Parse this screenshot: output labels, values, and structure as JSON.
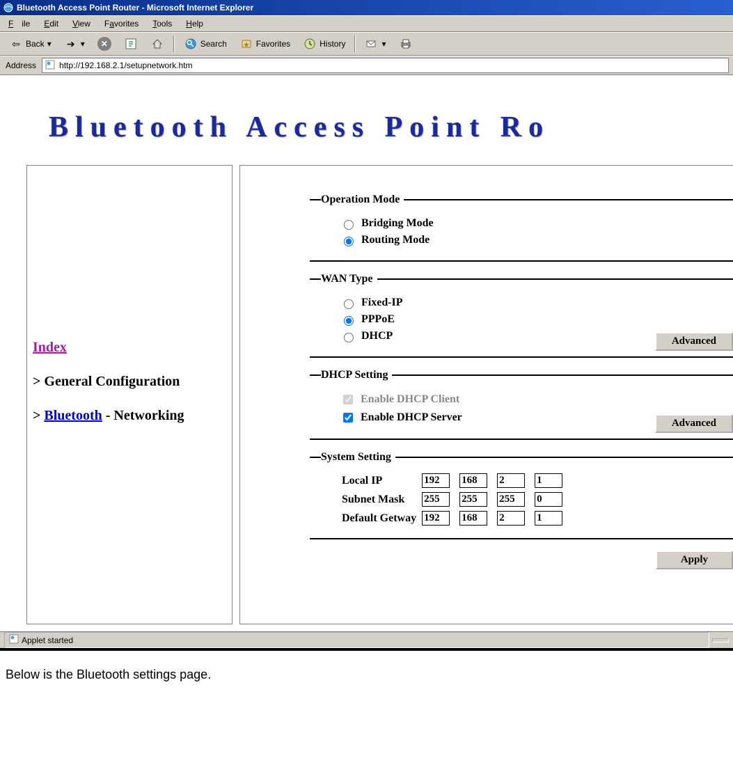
{
  "window": {
    "title": "Bluetooth Access Point Router - Microsoft Internet Explorer"
  },
  "menubar": {
    "file": "File",
    "edit": "Edit",
    "view": "View",
    "favorites": "Favorites",
    "tools": "Tools",
    "help": "Help"
  },
  "toolbar": {
    "back": "Back",
    "search": "Search",
    "favorites": "Favorites",
    "history": "History"
  },
  "addressbar": {
    "label": "Address",
    "url": "http://192.168.2.1/setupnetwork.htm"
  },
  "banner": "Bluetooth  Access  Point  Ro",
  "sidebar": {
    "index": "Index",
    "gt1": ">",
    "genconf": "General Configuration",
    "gt2": ">",
    "bluetooth": "Bluetooth",
    "dash": " - ",
    "networking": "Networking"
  },
  "form": {
    "opmode": {
      "legend": "Operation Mode",
      "bridging": "Bridging Mode",
      "routing": "Routing Mode",
      "selected": "routing"
    },
    "wantype": {
      "legend": "WAN Type",
      "fixed": "Fixed-IP",
      "pppoe": "PPPoE",
      "dhcp": "DHCP",
      "selected": "pppoe",
      "advanced": "Advanced"
    },
    "dhcp": {
      "legend": "DHCP Setting",
      "client": "Enable DHCP Client",
      "client_checked": true,
      "server": "Enable DHCP Server",
      "server_checked": true,
      "advanced": "Advanced"
    },
    "system": {
      "legend": "System Setting",
      "localip_label": "Local IP",
      "subnet_label": "Subnet Mask",
      "gateway_label": "Default Getway",
      "localip": [
        "192",
        "168",
        "2",
        "1"
      ],
      "subnet": [
        "255",
        "255",
        "255",
        "0"
      ],
      "gateway": [
        "192",
        "168",
        "2",
        "1"
      ]
    },
    "apply": "Apply"
  },
  "statusbar": {
    "text": "Applet started"
  },
  "caption": "Below is the Bluetooth settings page."
}
